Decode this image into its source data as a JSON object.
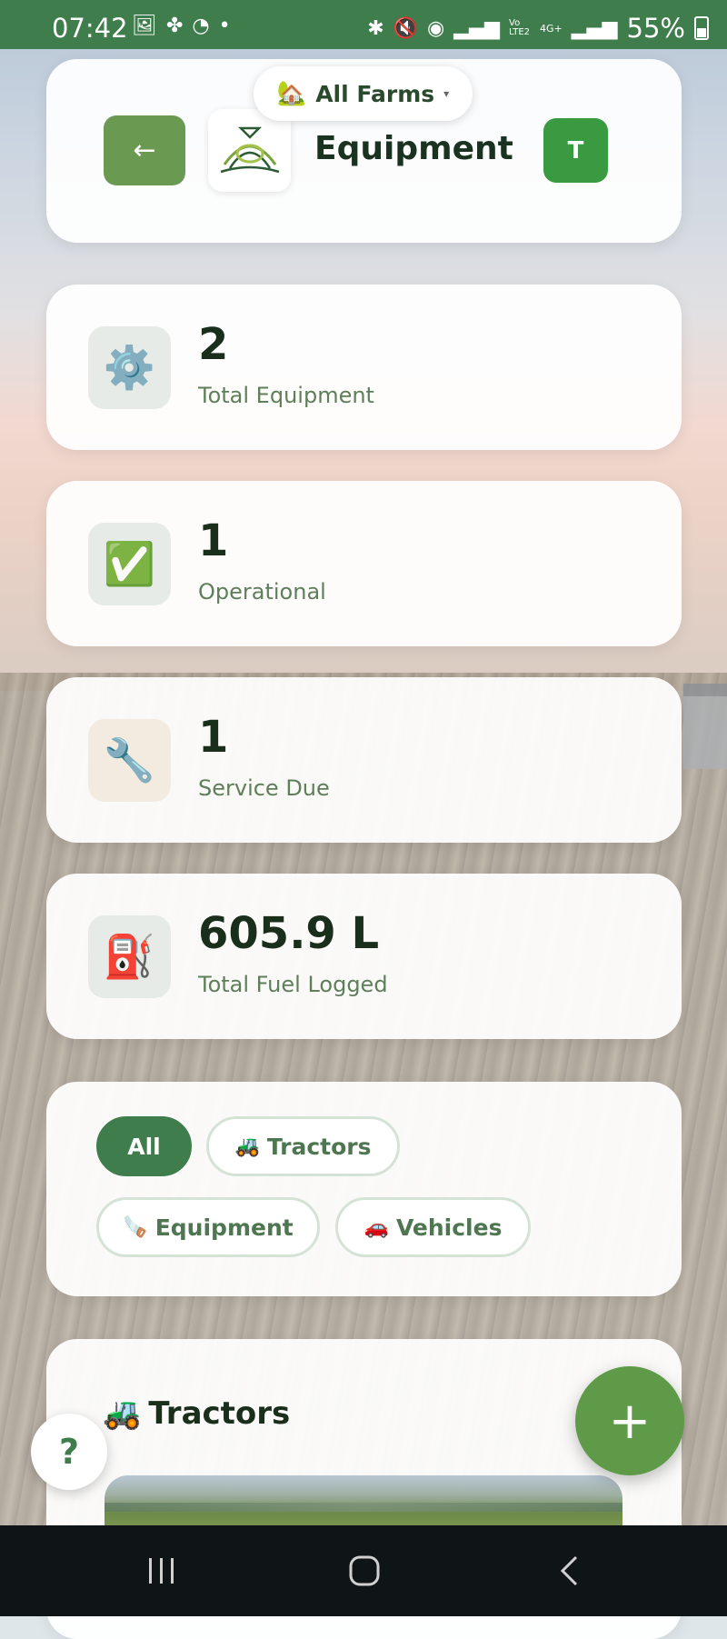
{
  "status_bar": {
    "time": "07:42",
    "battery": "55%",
    "left_icons": [
      "image-icon",
      "pinwheel-icon",
      "whatsapp-icon",
      "dot-icon"
    ],
    "right_icons": [
      "bluetooth-icon",
      "mute-icon",
      "hotspot-icon",
      "signal-icon",
      "volte-icon",
      "signal-icon"
    ],
    "network_label": "Vo LTE2",
    "network_label2": "4G+"
  },
  "header": {
    "back_label": "←",
    "title": "Equipment",
    "avatar_initial": "T",
    "farm_selector": {
      "emoji": "🏡",
      "label": "All Farms",
      "caret": "▾"
    }
  },
  "stats": [
    {
      "icon": "⚙️",
      "icon_name": "gear-icon",
      "value": "2",
      "label": "Total Equipment"
    },
    {
      "icon": "✅",
      "icon_name": "checkmark-icon",
      "value": "1",
      "label": "Operational"
    },
    {
      "icon": "🔧",
      "icon_name": "wrench-icon",
      "value": "1",
      "label": "Service Due"
    },
    {
      "icon": "⛽",
      "icon_name": "fuel-pump-icon",
      "value": "605.9 L",
      "label": "Total Fuel Logged"
    }
  ],
  "filters": [
    {
      "label": "All",
      "emoji": "",
      "active": true
    },
    {
      "label": "Tractors",
      "emoji": "🚜",
      "active": false
    },
    {
      "label": "Equipment",
      "emoji": "🪚",
      "active": false
    },
    {
      "label": "Vehicles",
      "emoji": "🚗",
      "active": false
    }
  ],
  "section": {
    "emoji": "🚜",
    "title": "Tractors"
  },
  "fab_label": "+",
  "help_label": "?",
  "colors": {
    "brand_green": "#3f7d4c",
    "accent_green": "#5e9a48",
    "text_dark": "#1a2e1c"
  }
}
